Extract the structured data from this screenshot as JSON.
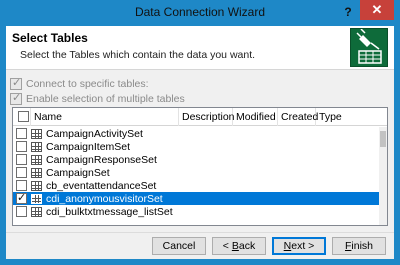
{
  "window": {
    "title": "Data Connection Wizard",
    "help_glyph": "?",
    "close_glyph": "✕"
  },
  "header": {
    "title": "Select Tables",
    "subtitle": "Select the Tables which contain the data you want.",
    "icon": "database-wizard-icon"
  },
  "options": {
    "connect_specific": {
      "label": "Connect to specific tables:",
      "checked": true,
      "enabled": false
    },
    "multiple_selection": {
      "label": "Enable selection of multiple tables",
      "checked": true,
      "enabled": false
    }
  },
  "table": {
    "columns": [
      "Name",
      "Description",
      "Modified",
      "Created",
      "Type"
    ],
    "rows": [
      {
        "name": "CampaignActivitySet",
        "checked": false
      },
      {
        "name": "CampaignItemSet",
        "checked": false
      },
      {
        "name": "CampaignResponseSet",
        "checked": false
      },
      {
        "name": "CampaignSet",
        "checked": false
      },
      {
        "name": "cb_eventattendanceSet",
        "checked": false
      },
      {
        "name": "cdi_anonymousvisitorSet",
        "checked": true,
        "selected": true
      },
      {
        "name": "cdi_bulktxtmessage_listSet",
        "checked": false
      }
    ]
  },
  "buttons": {
    "cancel": "Cancel",
    "back_arrow": "< ",
    "back_mnemonic": "B",
    "back_rest": "ack",
    "next_mnemonic": "N",
    "next_rest": "ext",
    "next_arrow": " >",
    "finish_mnemonic": "F",
    "finish_rest": "inish"
  },
  "colors": {
    "titlebar": "#1e88c7",
    "selection": "#0078d7",
    "close": "#c7413a",
    "icon_bg": "#0e6b3a"
  }
}
